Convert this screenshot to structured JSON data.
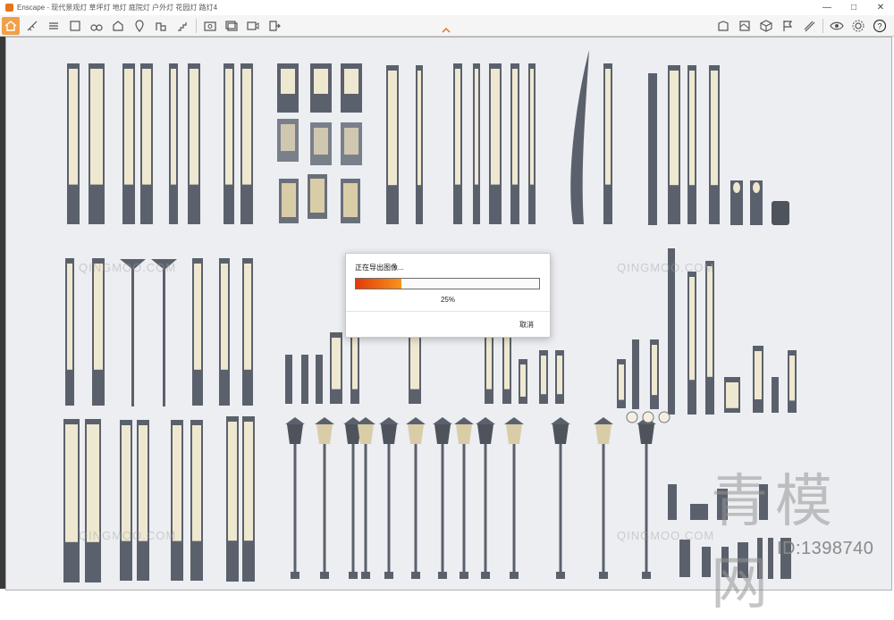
{
  "window": {
    "title": "Enscape - 现代景观灯 草坪灯 地灯 庭院灯 户外灯 花园灯 路灯4",
    "controls": [
      "minimize-icon",
      "maximize-icon",
      "close-icon"
    ]
  },
  "toolbar": {
    "left_icons": [
      "home-icon",
      "measure-icon",
      "bim-icon",
      "list-icon",
      "binoculars-icon",
      "house-icon",
      "map-pin-icon",
      "buildings-icon",
      "stairs-icon",
      "screenshot-icon",
      "batch-render-icon",
      "video-export-icon",
      "export-icon"
    ],
    "right_icons": [
      "asset-library-icon",
      "material-icon",
      "cube-icon",
      "flag-icon",
      "ruler-icon",
      "eye-icon",
      "settings-icon",
      "help-icon"
    ],
    "accent": "#f0a04a"
  },
  "dialog": {
    "title": "正在导出图像...",
    "progress_label": "25%",
    "progress_value": 0.25,
    "cancel_label": "取消",
    "progress_colors": [
      "#e33a05",
      "#f7941d"
    ]
  },
  "watermarks": {
    "site_cn": "青模网",
    "image_id": "ID:1398740",
    "brand_latin": "QINGMOO.COM"
  }
}
